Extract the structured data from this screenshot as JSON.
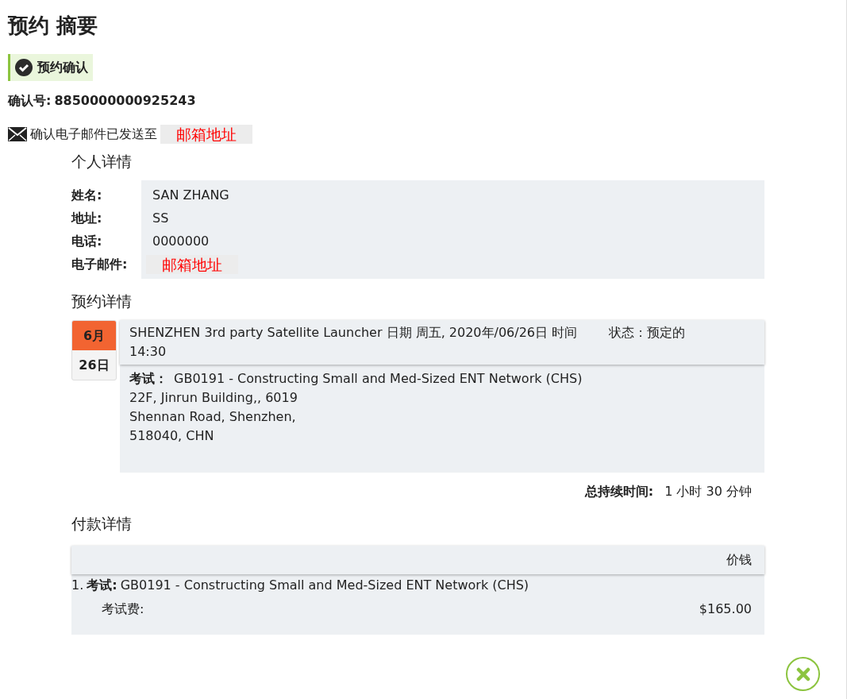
{
  "title": "预约 摘要",
  "confirmed_badge": "预约确认",
  "confirmation_number": {
    "label": "确认号:",
    "value": "8850000000925243"
  },
  "email_notice": {
    "text": "确认电子邮件已发送至",
    "address": "邮箱地址"
  },
  "personal": {
    "heading": "个人详情",
    "fields": [
      {
        "label": "姓名:",
        "value": "SAN ZHANG",
        "redacted": false
      },
      {
        "label": "地址:",
        "value": "SS",
        "redacted": false
      },
      {
        "label": "电话:",
        "value": "0000000",
        "redacted": false
      },
      {
        "label": "电子邮件:",
        "value": "邮箱地址",
        "redacted": true
      }
    ]
  },
  "booking": {
    "heading": "预约详情",
    "month": "6月",
    "day": "26日",
    "summary": "SHENZHEN 3rd party Satellite Launcher 日期 周五, 2020年/06/26日 时间 14:30",
    "status": "状态：预定的",
    "exam_label": "考试：",
    "exam": "GB0191 - Constructing Small and Med-Sized ENT Network (CHS)",
    "address_lines": [
      "22F, Jinrun Building,, 6019",
      "Shennan Road, Shenzhen,",
      "518040, CHN"
    ],
    "duration_label": "总持续时间:",
    "duration": "1 小时 30 分钟"
  },
  "payment": {
    "heading": "付款详情",
    "price_column": "价钱",
    "items": [
      {
        "number": "1.",
        "label": "考试:",
        "exam": "GB0191 - Constructing Small and Med-Sized ENT Network (CHS)",
        "fee_label": "考试费:",
        "fee": "$165.00"
      }
    ]
  }
}
